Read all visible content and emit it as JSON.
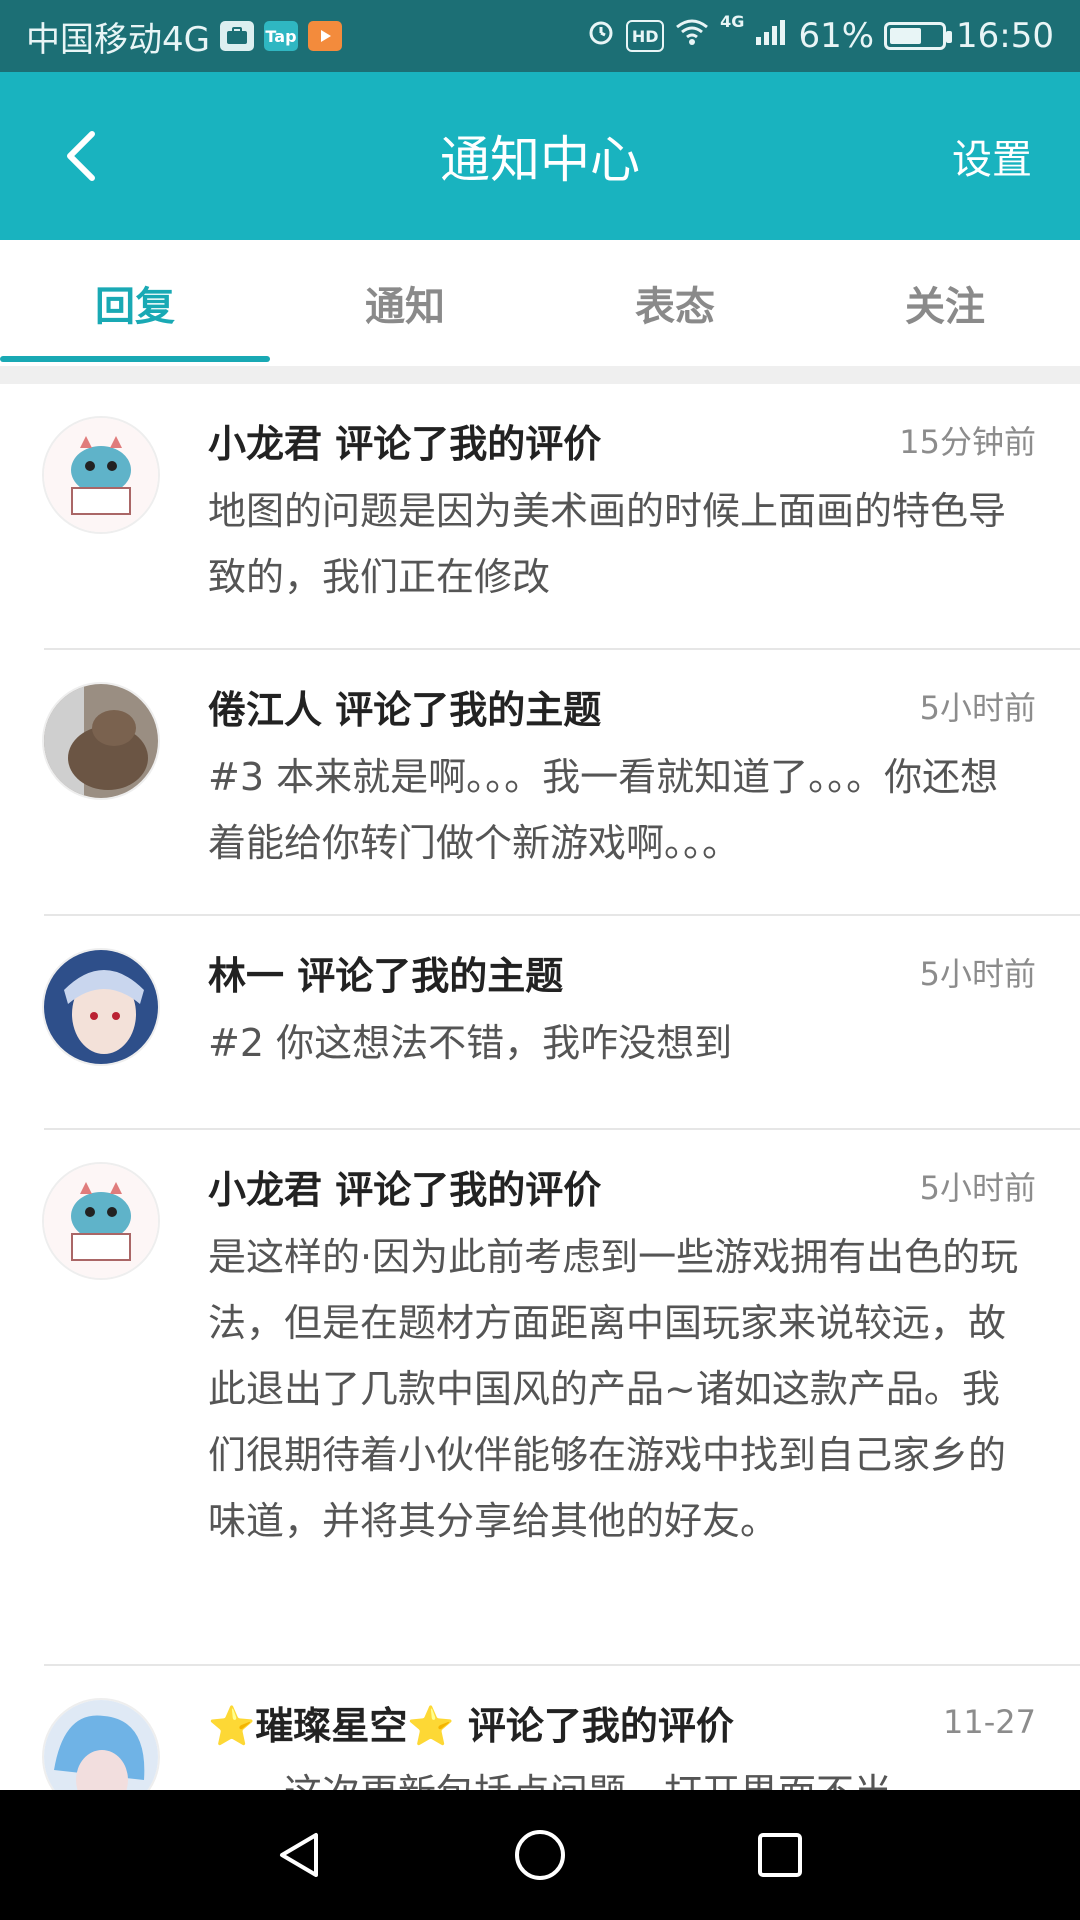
{
  "status_bar": {
    "carrier": "中国移动4G",
    "icons_left": [
      "briefcase-icon",
      "taptap-icon",
      "play-icon"
    ],
    "taptap_text": "Tap",
    "hd_text": "HD",
    "network": "4G",
    "battery_percent": "61%",
    "battery_level": 0.61,
    "time": "16:50"
  },
  "app_bar": {
    "title": "通知中心",
    "settings_label": "设置",
    "background": "#19b3bf"
  },
  "tabs": [
    {
      "label": "回复",
      "active": true
    },
    {
      "label": "通知",
      "active": false
    },
    {
      "label": "表态",
      "active": false
    },
    {
      "label": "关注",
      "active": false
    }
  ],
  "notifications": [
    {
      "user": "小龙君",
      "action": "评论了我的评价",
      "time": "15分钟前",
      "message": "地图的问题是因为美术画的时候上面画的特色导致的，我们正在修改",
      "avatar": "dragon"
    },
    {
      "user": "倦江人",
      "action": "评论了我的主题",
      "time": "5小时前",
      "message": "#3 本来就是啊。。。我一看就知道了。。。你还想着能给你转门做个新游戏啊。。。",
      "avatar": "cat"
    },
    {
      "user": "林一",
      "action": "评论了我的主题",
      "time": "5小时前",
      "message": "#2 你这想法不错，我咋没想到",
      "avatar": "anime"
    },
    {
      "user": "小龙君",
      "action": "评论了我的评价",
      "time": "5小时前",
      "message": "是这样的·因为此前考虑到一些游戏拥有出色的玩法，但是在题材方面距离中国玩家来说较远，故此退出了几款中国风的产品~诸如这款产品。我们很期待着小伙伴能够在游戏中找到自己家乡的味道，并将其分享给其他的好友。",
      "avatar": "dragon"
    },
    {
      "user": "⭐璀璨星空⭐",
      "action": "评论了我的评价",
      "time": "11-27",
      "message": "……这次更新包括点问题，打开界面不当",
      "avatar": "blue"
    }
  ],
  "nav": {
    "back": "triangle-back-icon",
    "home": "circle-home-icon",
    "recent": "square-recent-icon"
  }
}
